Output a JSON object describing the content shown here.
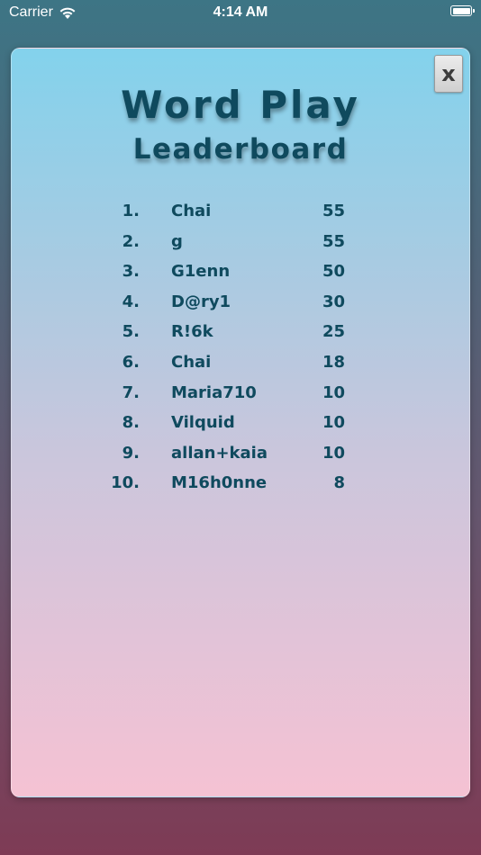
{
  "status_bar": {
    "carrier": "Carrier",
    "time": "4:14 AM",
    "icons": [
      "wifi-icon",
      "battery-icon"
    ]
  },
  "header": {
    "title": "Word Play",
    "subtitle": "Leaderboard",
    "close_label": "x"
  },
  "leaderboard": {
    "rows": [
      {
        "rank": "1.",
        "name": "Chai",
        "score": "55"
      },
      {
        "rank": "2.",
        "name": "g",
        "score": "55"
      },
      {
        "rank": "3.",
        "name": "G1enn",
        "score": "50"
      },
      {
        "rank": "4.",
        "name": "D@ry1",
        "score": "30"
      },
      {
        "rank": "5.",
        "name": "R!6k",
        "score": "25"
      },
      {
        "rank": "6.",
        "name": "Chai",
        "score": "18"
      },
      {
        "rank": "7.",
        "name": "Maria710",
        "score": "10"
      },
      {
        "rank": "8.",
        "name": "Vilquid",
        "score": "10"
      },
      {
        "rank": "9.",
        "name": "allan+kaia",
        "score": "10"
      },
      {
        "rank": "10.",
        "name": "M16h0nne",
        "score": "8"
      }
    ]
  },
  "colors": {
    "text": "#0f4a5e",
    "card_top": "#83d2ec",
    "card_bottom": "#f5c2d3",
    "background_top": "#3d7585",
    "background_bottom": "#7e3b55"
  }
}
